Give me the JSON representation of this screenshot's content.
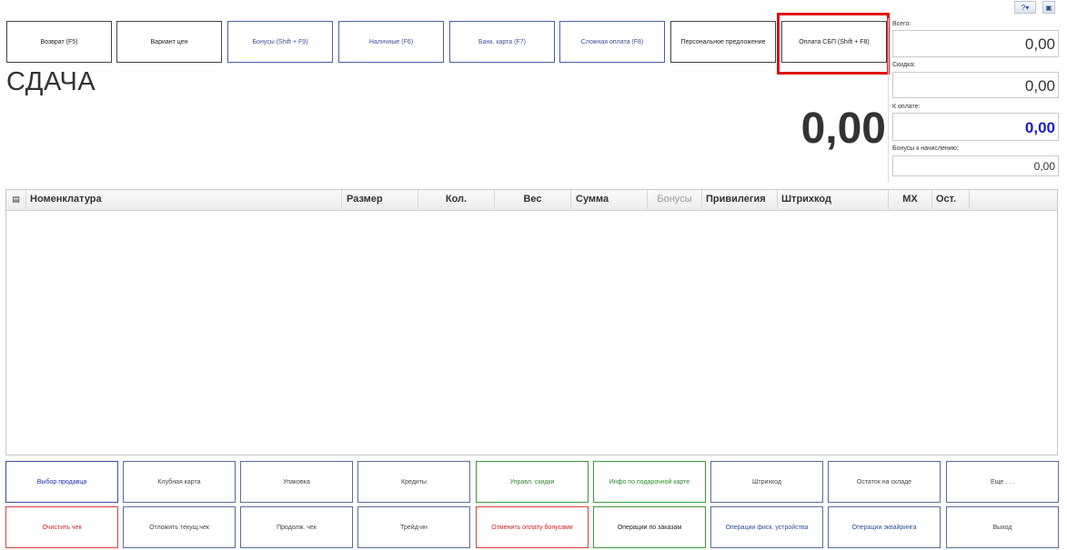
{
  "top_buttons": [
    {
      "label": "Возврат (F5)",
      "style": "dark"
    },
    {
      "label": "Вариант цен",
      "style": "dark"
    },
    {
      "label": "Бонусы (Shift + F9)",
      "style": "blue"
    },
    {
      "label": "Наличные (F6)",
      "style": "blue"
    },
    {
      "label": "Банк. карта (F7)",
      "style": "blue"
    },
    {
      "label": "Сложная оплата (F8)",
      "style": "blue"
    },
    {
      "label": "Персональное предложение",
      "style": "dark"
    },
    {
      "label": "Оплата СБП (Shift + F8)",
      "style": "dark"
    }
  ],
  "change": {
    "label": "СДАЧА",
    "amount": "0,00"
  },
  "totals": {
    "total_label": "Всего:",
    "total_value": "0,00",
    "discount_label": "Скидка:",
    "discount_value": "0,00",
    "to_pay_label": "К оплате:",
    "to_pay_value": "0,00",
    "bonus_label": "Бонусы к начислению:",
    "bonus_value": "0,00"
  },
  "table": {
    "columns": [
      "Номенклатура",
      "Размер",
      "Кол.",
      "Вес",
      "Сумма",
      "Бонусы",
      "Привилегия",
      "Штрихкод",
      "МХ",
      "Ост."
    ],
    "rows": []
  },
  "toolbar_icons": [
    "help-icon",
    "picture-icon"
  ],
  "bottom_row1": [
    {
      "label": "Выбор продавца",
      "style": "blue"
    },
    {
      "label": "Клубная карта",
      "style": "steel"
    },
    {
      "label": "Упаковка",
      "style": "steel"
    },
    {
      "label": "Кредиты",
      "style": "steel"
    },
    {
      "label": "Управл. скидки",
      "style": "green"
    },
    {
      "label": "Инфо по подарочной карте",
      "style": "green"
    },
    {
      "label": "Штрихкод",
      "style": "steel"
    },
    {
      "label": "Остаток на складе",
      "style": "steel"
    },
    {
      "label": "Еще . . .",
      "style": "steel"
    }
  ],
  "bottom_row2": [
    {
      "label": "Очистить чек",
      "style": "red"
    },
    {
      "label": "Отложить текущ.чек",
      "style": "steel"
    },
    {
      "label": "Продолж. чек",
      "style": "steel"
    },
    {
      "label": "Трейд-ин",
      "style": "steel"
    },
    {
      "label": "Отменить оплату бонусами",
      "style": "red"
    },
    {
      "label": "Операции по заказам",
      "style": "greendark"
    },
    {
      "label": "Операции фиск. устройства",
      "style": "steelblue"
    },
    {
      "label": "Операции эквайринга",
      "style": "steelblue"
    },
    {
      "label": "Выход",
      "style": "steel"
    }
  ],
  "colors": {
    "highlight": "#e01010",
    "to_pay": "#1a1ad0"
  }
}
